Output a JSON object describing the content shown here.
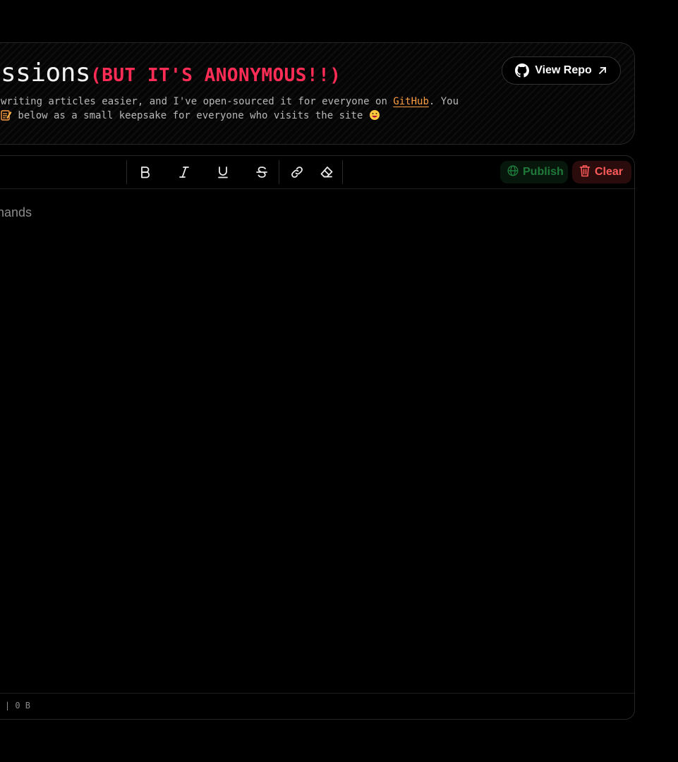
{
  "header": {
    "title_main": "ssions",
    "title_accent": "(BUT IT'S ANONYMOUS!!)",
    "desc_line1_before": "writing articles easier, and I've open-sourced it for everyone on ",
    "desc_link": "GitHub",
    "desc_line1_after": ". You",
    "desc_line2": " below as a small keepsake for everyone who visits the site ",
    "repo_button": "View Repo"
  },
  "toolbar": {
    "bold": "B",
    "italic": "I",
    "underline": "U",
    "strike": "S",
    "publish": "Publish",
    "clear": "Clear"
  },
  "editor": {
    "placeholder": "nands"
  },
  "status": {
    "text": "| 0 B"
  },
  "colors": {
    "accent_red": "#ff2d55",
    "link_orange": "#ff9f43",
    "publish_green": "#1f7a3a",
    "clear_red": "#ff5a5a"
  },
  "icons": {
    "repo": "github-icon",
    "repo_arrow": "arrow-up-right-icon",
    "bold": "bold-icon",
    "italic": "italic-icon",
    "underline": "underline-icon",
    "strike": "strikethrough-icon",
    "link": "link-icon",
    "eraser": "eraser-icon",
    "publish": "globe-icon",
    "clear": "trash-icon"
  }
}
